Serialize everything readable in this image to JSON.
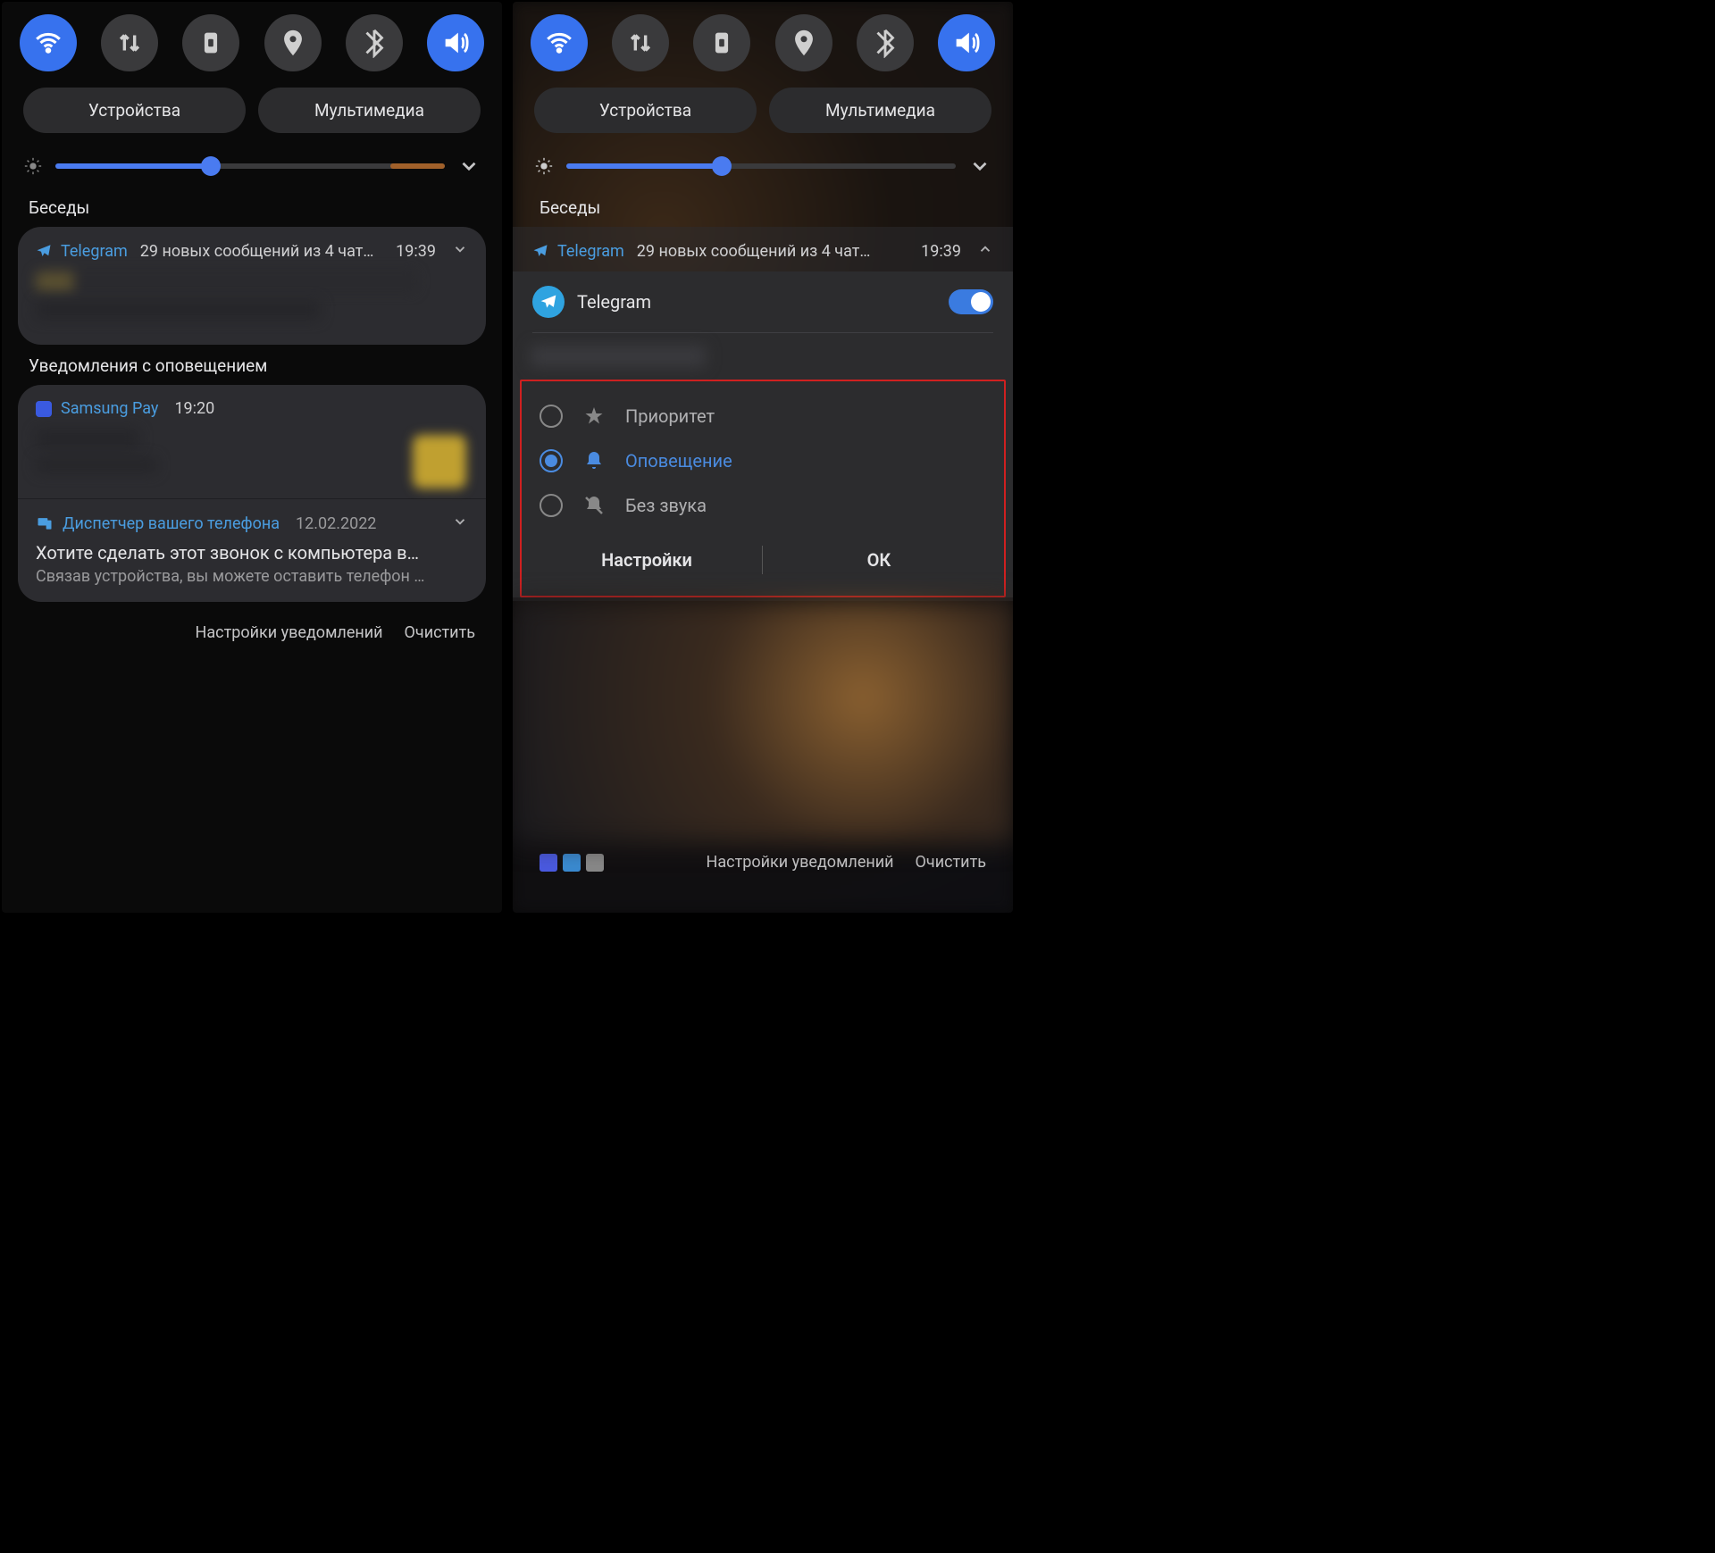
{
  "pills": {
    "devices": "Устройства",
    "media": "Мультимедиа"
  },
  "slider": {
    "fill": 40,
    "accent": 14
  },
  "left": {
    "section1": "Беседы",
    "telegram": {
      "app": "Telegram",
      "text": "29 новых сообщений из 4 чат…",
      "time": "19:39"
    },
    "section2": "Уведомления с оповещением",
    "samsung": {
      "app": "Samsung Pay",
      "time": "19:20"
    },
    "yourphone": {
      "app": "Диспетчер вашего телефона",
      "date": "12.02.2022",
      "title": "Хотите сделать этот звонок с компьютера в…",
      "sub": "Связав устройства, вы можете оставить телефон …"
    },
    "footer": {
      "settings": "Настройки уведомлений",
      "clear": "Очистить"
    }
  },
  "right": {
    "section1": "Беседы",
    "telegram": {
      "app": "Telegram",
      "text": "29 новых сообщений из 4 чат…",
      "time": "19:39"
    },
    "toggle": "Telegram",
    "opts": {
      "priority": "Приоритет",
      "alert": "Оповещение",
      "silent": "Без звука"
    },
    "actions": {
      "settings": "Настройки",
      "ok": "ОК"
    },
    "footer": {
      "settings": "Настройки уведомлений",
      "clear": "Очистить"
    }
  }
}
